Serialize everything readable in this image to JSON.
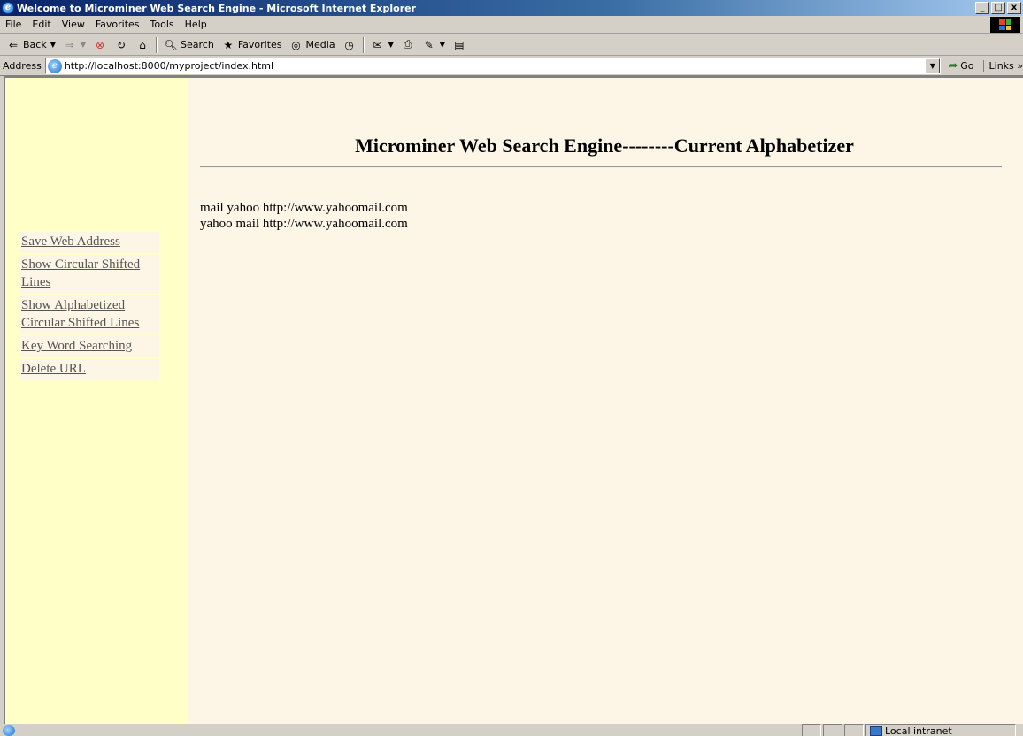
{
  "window": {
    "title": "Welcome to Microminer Web Search Engine - Microsoft Internet Explorer",
    "controls": [
      "_",
      "□",
      "x"
    ]
  },
  "menubar": {
    "items": [
      "File",
      "Edit",
      "View",
      "Favorites",
      "Tools",
      "Help"
    ]
  },
  "toolbar": {
    "back_label": "Back",
    "search_label": "Search",
    "favorites_label": "Favorites",
    "media_label": "Media"
  },
  "addressbar": {
    "label": "Address",
    "url": "http://localhost:8000/myproject/index.html",
    "go_label": "Go",
    "links_label": "Links »"
  },
  "sidebar": {
    "links": [
      "Save Web Address",
      "Show Circular Shifted Lines",
      "Show Alphabetized Circular Shifted Lines",
      "Key Word Searching",
      "Delete URL"
    ]
  },
  "main": {
    "heading": "Microminer Web Search Engine--------Current Alphabetizer",
    "results": [
      "mail yahoo http://www.yahoomail.com",
      "yahoo mail http://www.yahoomail.com"
    ]
  },
  "statusbar": {
    "zone_label": "Local intranet"
  },
  "colors": {
    "sidebar_bg": "#ffffc8",
    "content_bg": "#fdf5e6",
    "titlebar": "#0a246a"
  }
}
